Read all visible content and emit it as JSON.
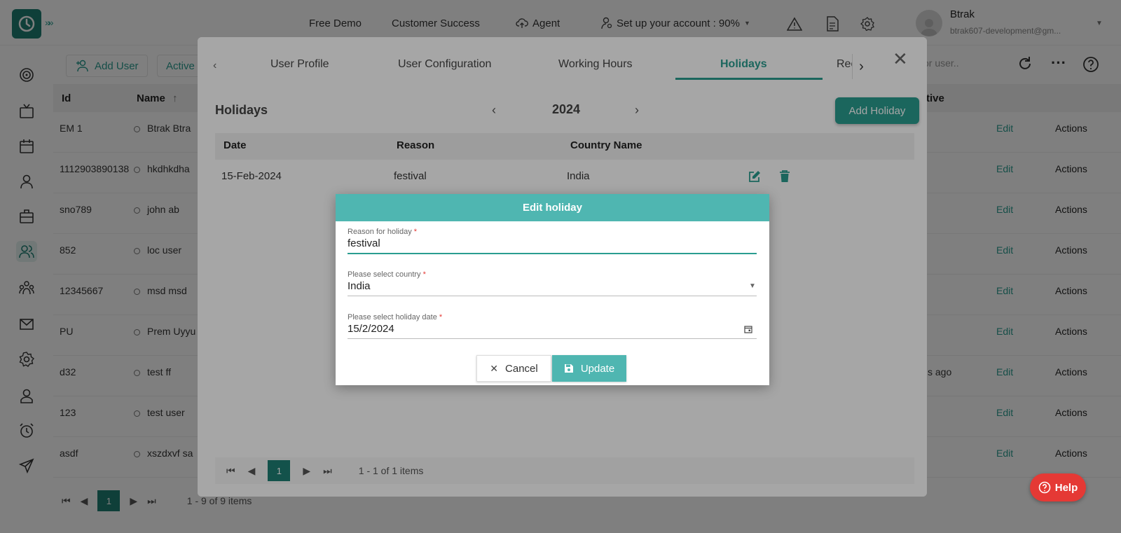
{
  "topbar": {
    "free_demo": "Free Demo",
    "customer_success": "Customer Success",
    "agent": "Agent",
    "setup": "Set up your account : 90%",
    "user_name": "Btrak",
    "user_email": "btrak607-development@gm..."
  },
  "toolbar": {
    "add_user": "Add User",
    "active": "Active",
    "search_placeholder": "or user.."
  },
  "table": {
    "headers": {
      "id": "Id",
      "name": "Name",
      "active": "tive"
    },
    "rows": [
      {
        "id": "EM 1",
        "name": "Btrak Btra",
        "active": "",
        "edit": "Edit",
        "actions": "Actions"
      },
      {
        "id": "1112903890138",
        "name": "hkdhkdha",
        "active": "",
        "edit": "Edit",
        "actions": "Actions"
      },
      {
        "id": "sno789",
        "name": "john ab",
        "active": "",
        "edit": "Edit",
        "actions": "Actions"
      },
      {
        "id": "852",
        "name": "loc user",
        "active": "",
        "edit": "Edit",
        "actions": "Actions"
      },
      {
        "id": "12345667",
        "name": "msd msd",
        "active": "",
        "edit": "Edit",
        "actions": "Actions"
      },
      {
        "id": "PU",
        "name": "Prem Uyyu",
        "active": "",
        "edit": "Edit",
        "actions": "Actions"
      },
      {
        "id": "d32",
        "name": "test ff",
        "active": "s ago",
        "edit": "Edit",
        "actions": "Actions"
      },
      {
        "id": "123",
        "name": "test user",
        "active": "",
        "edit": "Edit",
        "actions": "Actions"
      },
      {
        "id": "asdf",
        "name": "xszdxvf sa",
        "active": "",
        "edit": "Edit",
        "actions": "Actions"
      }
    ]
  },
  "pager": {
    "page": "1",
    "summary": "1 - 9 of 9 items"
  },
  "help": {
    "label": "Help"
  },
  "dialog": {
    "tabs": [
      "User Profile",
      "User Configuration",
      "Working Hours",
      "Holidays",
      "Rec"
    ],
    "holidays_title": "Holidays",
    "year": "2024",
    "add_holiday": "Add Holiday",
    "columns": {
      "date": "Date",
      "reason": "Reason",
      "country": "Country Name"
    },
    "rows": [
      {
        "date": "15-Feb-2024",
        "reason": "festival",
        "country": "India"
      }
    ],
    "pager": {
      "page": "1",
      "summary": "1 - 1 of 1 items"
    }
  },
  "edit_holiday": {
    "title": "Edit holiday",
    "reason_label": "Reason for holiday",
    "reason_value": "festival",
    "country_label": "Please select country",
    "country_value": "India",
    "date_label": "Please select holiday date",
    "date_value": "15/2/2024",
    "required_mark": "*",
    "cancel": "Cancel",
    "update": "Update"
  },
  "colors": {
    "brand": "#1e7f73",
    "accent": "#2a9d90",
    "dialog_header": "#4fb6b1",
    "help": "#e53935"
  },
  "icons": [
    "logo-icon",
    "expand-icon",
    "cloud-upload-icon",
    "user-setup-icon",
    "warning-icon",
    "document-icon",
    "settings-icon",
    "refresh-icon",
    "more-icon",
    "help-circle-icon",
    "close-icon",
    "edit-icon",
    "delete-icon",
    "calendar-icon",
    "save-icon"
  ]
}
